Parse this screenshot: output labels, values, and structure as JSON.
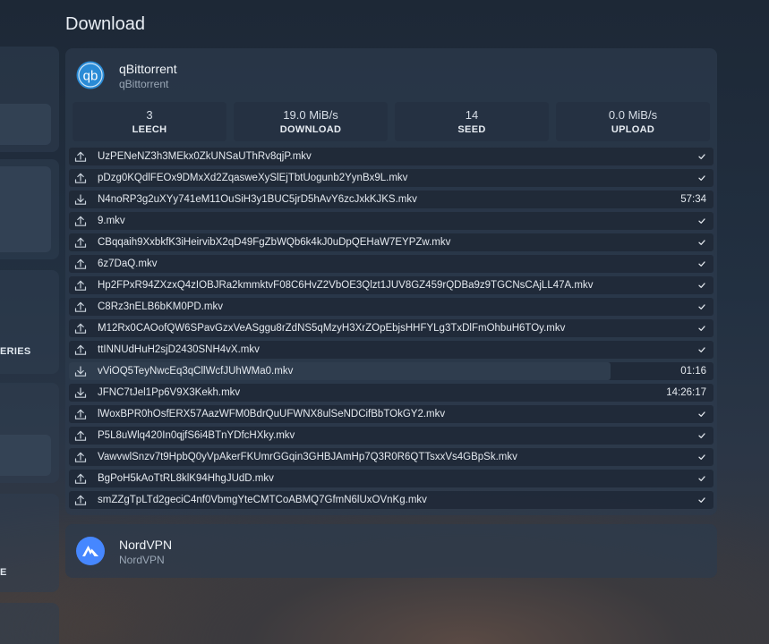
{
  "section": {
    "title": "Download"
  },
  "left_panel": {
    "labels": [
      "ERIES",
      "E"
    ]
  },
  "qbittorrent": {
    "name": "qBittorrent",
    "subtitle": "qBittorrent",
    "icon_text": "qb",
    "accent": "#2a8bd6",
    "stats": [
      {
        "value": "3",
        "label": "LEECH"
      },
      {
        "value": "19.0 MiB/s",
        "label": "DOWNLOAD"
      },
      {
        "value": "14",
        "label": "SEED"
      },
      {
        "value": "0.0 MiB/s",
        "label": "UPLOAD"
      }
    ],
    "torrents": [
      {
        "name": "UzPENeNZ3h3MEkx0ZkUNSaUThRv8qjP.mkv",
        "direction": "upload",
        "status": "check",
        "progress": 1.0
      },
      {
        "name": "pDzg0KQdlFEOx9DMxXd2ZqasweXySlEjTbtUogunb2YynBx9L.mkv",
        "direction": "upload",
        "status": "check",
        "progress": 1.0
      },
      {
        "name": "N4noRP3g2uXYy741eM11OuSiH3y1BUC5jrD5hAvY6zcJxkKJKS.mkv",
        "direction": "download",
        "status": "57:34",
        "progress": 0.0
      },
      {
        "name": "9.mkv",
        "direction": "upload",
        "status": "check",
        "progress": 1.0
      },
      {
        "name": "CBqqaih9XxbkfK3iHeirvibX2qD49FgZbWQb6k4kJ0uDpQEHaW7EYPZw.mkv",
        "direction": "upload",
        "status": "check",
        "progress": 1.0
      },
      {
        "name": "6z7DaQ.mkv",
        "direction": "upload",
        "status": "check",
        "progress": 1.0
      },
      {
        "name": "Hp2FPxR94ZXzxQ4zIOBJRa2kmmktvF08C6HvZ2VbOE3Qlzt1JUV8GZ459rQDBa9z9TGCNsCAjLL47A.mkv",
        "direction": "upload",
        "status": "check",
        "progress": 1.0
      },
      {
        "name": "C8Rz3nELB6bKM0PD.mkv",
        "direction": "upload",
        "status": "check",
        "progress": 1.0
      },
      {
        "name": "M12Rx0CAOofQW6SPavGzxVeASggu8rZdNS5qMzyH3XrZOpEbjsHHFYLg3TxDlFmOhbuH6TOy.mkv",
        "direction": "upload",
        "status": "check",
        "progress": 1.0
      },
      {
        "name": "ttINNUdHuH2sjD2430SNH4vX.mkv",
        "direction": "upload",
        "status": "check",
        "progress": 1.0
      },
      {
        "name": "vViOQ5TeyNwcEq3qCllWcfJUhWMa0.mkv",
        "direction": "download",
        "status": "01:16",
        "progress": 0.84
      },
      {
        "name": "JFNC7tJel1Pp6V9X3Kekh.mkv",
        "direction": "download",
        "status": "14:26:17",
        "progress": 0.0
      },
      {
        "name": "lWoxBPR0hOsfERX57AazWFM0BdrQuUFWNX8ulSeNDCifBbTOkGY2.mkv",
        "direction": "upload",
        "status": "check",
        "progress": 1.0
      },
      {
        "name": "P5L8uWlq420In0qjfS6i4BTnYDfcHXky.mkv",
        "direction": "upload",
        "status": "check",
        "progress": 1.0
      },
      {
        "name": "VawvwlSnzv7t9HpbQ0yVpAkerFKUmrGGqin3GHBJAmHp7Q3R0R6QTTsxxVs4GBpSk.mkv",
        "direction": "upload",
        "status": "check",
        "progress": 1.0
      },
      {
        "name": "BgPoH5kAoTtRL8klK94HhgJUdD.mkv",
        "direction": "upload",
        "status": "check",
        "progress": 1.0
      },
      {
        "name": "smZZgTpLTd2geciC4nf0VbmgYteCMTCoABMQ7GfmN6lUxOVnKg.mkv",
        "direction": "upload",
        "status": "check",
        "progress": 1.0
      }
    ]
  },
  "nordvpn": {
    "name": "NordVPN",
    "subtitle": "NordVPN",
    "accent": "#4687ff"
  }
}
